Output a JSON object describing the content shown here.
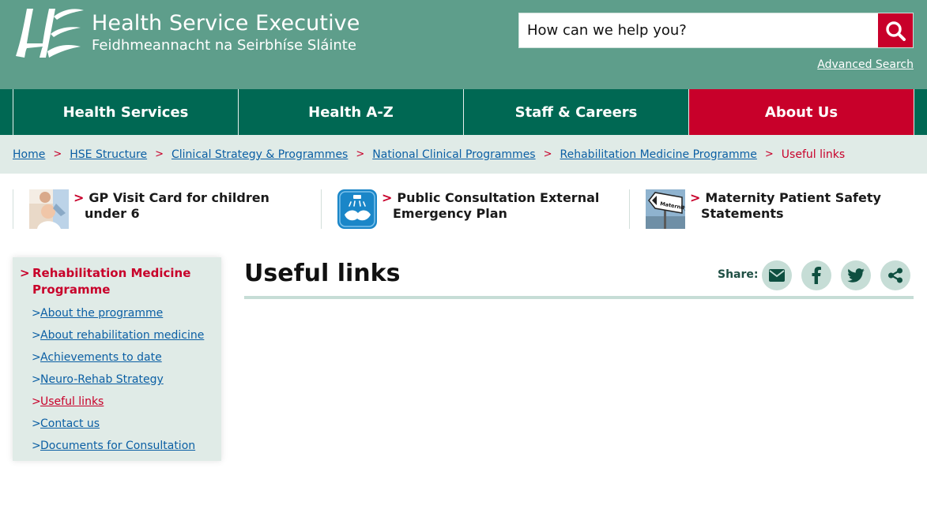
{
  "brand": {
    "title": "Health Service Executive",
    "subtitle": "Feidhmeannacht na Seirbhíse Sláinte",
    "logo_icon": "hse-logo-icon"
  },
  "search": {
    "placeholder": "How can we help you?",
    "button_icon": "search-icon",
    "advanced": "Advanced Search"
  },
  "nav": {
    "items": [
      {
        "label": "Health Services"
      },
      {
        "label": "Health A-Z"
      },
      {
        "label": "Staff & Careers"
      },
      {
        "label": "About Us"
      }
    ],
    "active": "About Us"
  },
  "breadcrumb": {
    "separator": ">",
    "items": [
      {
        "label": "Home"
      },
      {
        "label": "HSE Structure"
      },
      {
        "label": "Clinical Strategy & Programmes"
      },
      {
        "label": "National Clinical Programmes"
      },
      {
        "label": "Rehabilitation Medicine Programme"
      }
    ],
    "current": "Useful links"
  },
  "promos": [
    {
      "line1": "GP Visit Card for children",
      "line2": "under 6",
      "image": "child-doctor-photo"
    },
    {
      "line1": "Public Consultation External",
      "line2": "Emergency Plan",
      "image": "handwash-icon"
    },
    {
      "line1": "Maternity Patient Safety",
      "line2": "Statements",
      "image": "maternity-sign-photo"
    }
  ],
  "sidenav": {
    "title": "Rehabilitation Medicine Programme",
    "links": [
      {
        "label": "About the programme"
      },
      {
        "label": "About rehabilitation medicine"
      },
      {
        "label": "Achievements to date"
      },
      {
        "label": "Neuro-Rehab Strategy"
      },
      {
        "label": "Useful links"
      },
      {
        "label": "Contact us"
      },
      {
        "label": "Documents for Consultation"
      }
    ],
    "current": "Useful links"
  },
  "main": {
    "title": "Useful links",
    "share_label": "Share:",
    "share_icons": [
      "email-icon",
      "facebook-icon",
      "twitter-icon",
      "share-icon"
    ]
  },
  "colors": {
    "header_green": "#5e9e8b",
    "nav_green": "#006853",
    "accent_red": "#c8002a",
    "light_green": "#e0ebe7",
    "link_blue": "#0b5fa4"
  }
}
